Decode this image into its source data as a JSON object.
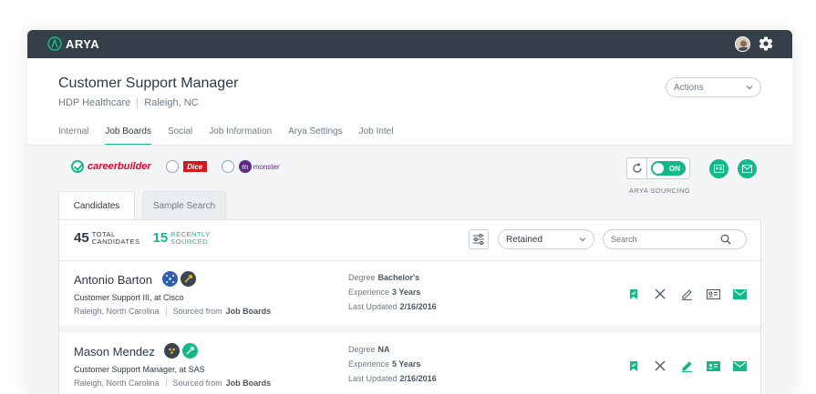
{
  "app": {
    "name": "ARYA"
  },
  "job": {
    "title": "Customer Support Manager",
    "company": "HDP Healthcare",
    "location": "Raleigh, NC",
    "actions_label": "Actions"
  },
  "tabs": [
    "Internal",
    "Job Boards",
    "Social",
    "Job Information",
    "Arya Settings",
    "Job Intel"
  ],
  "active_tab": "Job Boards",
  "boards": {
    "careerbuilder": "careerbuilder",
    "dice": "Dice",
    "monster": "monster"
  },
  "sourcing": {
    "toggle_label": "ON",
    "label": "ARYA SOURCING"
  },
  "candidate_tabs": [
    "Candidates",
    "Sample Search"
  ],
  "stats": {
    "total_count": "45",
    "total_label_1": "TOTAL",
    "total_label_2": "CANDIDATES",
    "recent_count": "15",
    "recent_label_1": "RECENTLY",
    "recent_label_2": "SOURCED"
  },
  "filter": {
    "selected": "Retained"
  },
  "search": {
    "placeholder": "Search"
  },
  "candidates": [
    {
      "name": "Antonio Barton",
      "title": "Customer Support III, at Cisco",
      "location": "Raleigh, North Carolina",
      "sourced_label": "Sourced from",
      "sourced_from": "Job Boards",
      "degree_label": "Degree",
      "degree": "Bachelor's",
      "experience_label": "Experience",
      "experience": "3 Years",
      "updated_label": "Last Updated",
      "updated": "2/16/2016"
    },
    {
      "name": "Mason Mendez",
      "title": "Customer Support Manager, at SAS",
      "location": "Raleigh, North Carolina",
      "sourced_label": "Sourced from",
      "sourced_from": "Job Boards",
      "degree_label": "Degree",
      "degree": "NA",
      "experience_label": "Experience",
      "experience": "5 Years",
      "updated_label": "Last Updated",
      "updated": "2/16/2016"
    }
  ],
  "colors": {
    "accent": "#13b987",
    "topbar": "#353f4a"
  }
}
